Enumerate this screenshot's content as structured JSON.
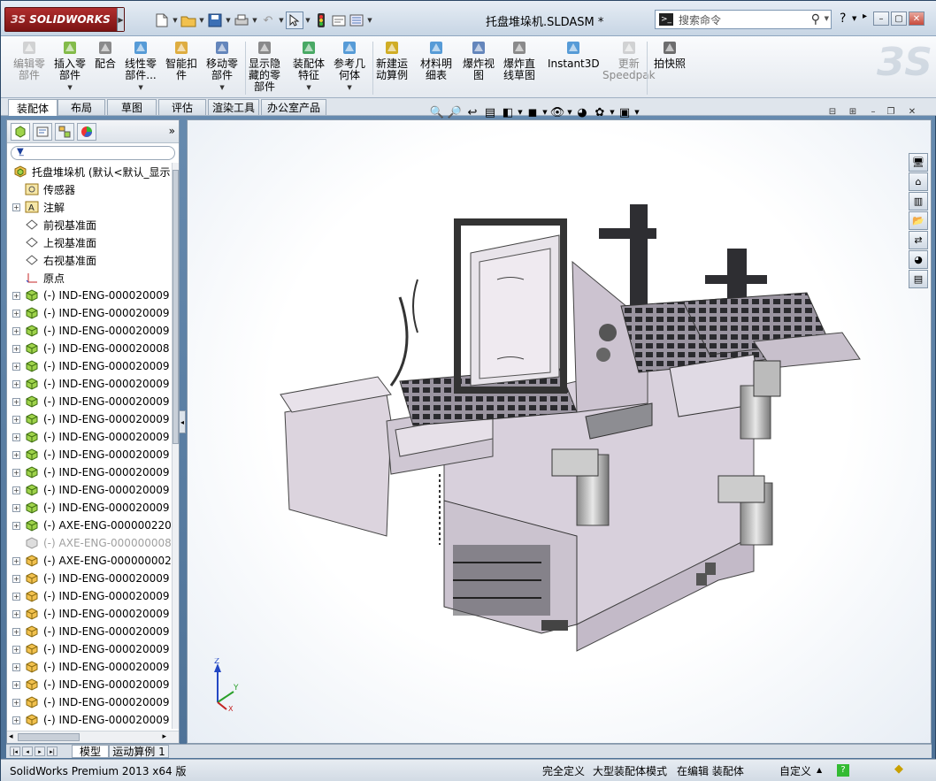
{
  "app": {
    "brand": "SOLIDWORKS",
    "title": "托盘堆垛机.SLDASM *",
    "search_placeholder": "搜索命令",
    "help_icon": "?"
  },
  "commands": [
    {
      "label1": "编辑零",
      "label2": "部件",
      "icon": "edit-component-icon",
      "disabled": true,
      "dropdown": false
    },
    {
      "label1": "插入零",
      "label2": "部件",
      "icon": "insert-component-icon",
      "disabled": false,
      "dropdown": true
    },
    {
      "label1": "配合",
      "label2": "",
      "icon": "mate-icon",
      "disabled": false,
      "dropdown": false
    },
    {
      "label1": "线性零",
      "label2": "部件...",
      "icon": "linear-pattern-icon",
      "disabled": false,
      "dropdown": true
    },
    {
      "label1": "智能扣",
      "label2": "件",
      "icon": "smart-fastener-icon",
      "disabled": false,
      "dropdown": false
    },
    {
      "label1": "移动零",
      "label2": "部件",
      "icon": "move-component-icon",
      "disabled": false,
      "dropdown": true
    },
    {
      "label1": "显示隐",
      "label2": "藏的零",
      "label3": "部件",
      "icon": "show-hidden-icon",
      "disabled": false,
      "dropdown": false
    },
    {
      "label1": "装配体",
      "label2": "特征",
      "icon": "assembly-feature-icon",
      "disabled": false,
      "dropdown": true
    },
    {
      "label1": "参考几",
      "label2": "何体",
      "icon": "reference-geometry-icon",
      "disabled": false,
      "dropdown": true
    },
    {
      "label1": "新建运",
      "label2": "动算例",
      "icon": "motion-study-icon",
      "disabled": false,
      "dropdown": false
    },
    {
      "label1": "材料明",
      "label2": "细表",
      "icon": "bom-icon",
      "disabled": false,
      "dropdown": false
    },
    {
      "label1": "爆炸视",
      "label2": "图",
      "icon": "exploded-view-icon",
      "disabled": false,
      "dropdown": false
    },
    {
      "label1": "爆炸直",
      "label2": "线草图",
      "icon": "explode-line-icon",
      "disabled": false,
      "dropdown": false
    },
    {
      "label1": "Instant3D",
      "label2": "",
      "icon": "instant3d-icon",
      "disabled": false,
      "dropdown": false
    },
    {
      "label1": "更新",
      "label2": "Speedpak",
      "icon": "speedpak-icon",
      "disabled": true,
      "dropdown": false
    },
    {
      "label1": "拍快照",
      "label2": "",
      "icon": "snapshot-icon",
      "disabled": false,
      "dropdown": false
    }
  ],
  "tabs": [
    "装配体",
    "布局",
    "草图",
    "评估",
    "渲染工具",
    "办公室产品"
  ],
  "tree": {
    "root": "托盘堆垛机 (默认<默认_显示",
    "items": [
      {
        "label": "传感器",
        "icon": "sensor-icon",
        "exp": false,
        "dim": false
      },
      {
        "label": "注解",
        "icon": "annotation-icon",
        "exp": true,
        "dim": false
      },
      {
        "label": "前视基准面",
        "icon": "plane-icon",
        "exp": false,
        "dim": false
      },
      {
        "label": "上视基准面",
        "icon": "plane-icon",
        "exp": false,
        "dim": false
      },
      {
        "label": "右视基准面",
        "icon": "plane-icon",
        "exp": false,
        "dim": false
      },
      {
        "label": "原点",
        "icon": "origin-icon",
        "exp": false,
        "dim": false
      },
      {
        "label": "(-) IND-ENG-000020009",
        "icon": "subassembly-icon",
        "exp": true,
        "dim": false
      },
      {
        "label": "(-) IND-ENG-000020009",
        "icon": "subassembly-icon",
        "exp": true,
        "dim": false
      },
      {
        "label": "(-) IND-ENG-000020009",
        "icon": "subassembly-icon",
        "exp": true,
        "dim": false
      },
      {
        "label": "(-) IND-ENG-000020008",
        "icon": "subassembly-icon",
        "exp": true,
        "dim": false
      },
      {
        "label": "(-) IND-ENG-000020009",
        "icon": "subassembly-icon",
        "exp": true,
        "dim": false
      },
      {
        "label": "(-) IND-ENG-000020009",
        "icon": "subassembly-icon",
        "exp": true,
        "dim": false
      },
      {
        "label": "(-) IND-ENG-000020009",
        "icon": "subassembly-icon",
        "exp": true,
        "dim": false
      },
      {
        "label": "(-) IND-ENG-000020009",
        "icon": "subassembly-icon",
        "exp": true,
        "dim": false
      },
      {
        "label": "(-) IND-ENG-000020009",
        "icon": "subassembly-icon",
        "exp": true,
        "dim": false
      },
      {
        "label": "(-) IND-ENG-000020009",
        "icon": "subassembly-icon",
        "exp": true,
        "dim": false
      },
      {
        "label": "(-) IND-ENG-000020009",
        "icon": "subassembly-icon",
        "exp": true,
        "dim": false
      },
      {
        "label": "(-) IND-ENG-000020009",
        "icon": "subassembly-icon",
        "exp": true,
        "dim": false
      },
      {
        "label": "(-) IND-ENG-000020009",
        "icon": "subassembly-icon",
        "exp": true,
        "dim": false
      },
      {
        "label": "(-) AXE-ENG-000000220",
        "icon": "subassembly-icon",
        "exp": true,
        "dim": false
      },
      {
        "label": "(-) AXE-ENG-000000008",
        "icon": "suppressed-icon",
        "exp": false,
        "dim": true
      },
      {
        "label": "(-) AXE-ENG-000000002",
        "icon": "part-icon",
        "exp": true,
        "dim": false
      },
      {
        "label": "(-) IND-ENG-000020009",
        "icon": "part-icon",
        "exp": true,
        "dim": false
      },
      {
        "label": "(-) IND-ENG-000020009",
        "icon": "part-icon",
        "exp": true,
        "dim": false
      },
      {
        "label": "(-) IND-ENG-000020009",
        "icon": "part-icon",
        "exp": true,
        "dim": false
      },
      {
        "label": "(-) IND-ENG-000020009",
        "icon": "part-icon",
        "exp": true,
        "dim": false
      },
      {
        "label": "(-) IND-ENG-000020009",
        "icon": "part-icon",
        "exp": true,
        "dim": false
      },
      {
        "label": "(-) IND-ENG-000020009",
        "icon": "part-icon",
        "exp": true,
        "dim": false
      },
      {
        "label": "(-) IND-ENG-000020009",
        "icon": "part-icon",
        "exp": true,
        "dim": false
      },
      {
        "label": "(-) IND-ENG-000020009",
        "icon": "part-icon",
        "exp": true,
        "dim": false
      },
      {
        "label": "(-) IND-ENG-000020009",
        "icon": "part-icon",
        "exp": true,
        "dim": false
      }
    ]
  },
  "model_tabs": [
    "模型",
    "运动算例 1"
  ],
  "status": {
    "product": "SolidWorks Premium 2013 x64 版",
    "defined": "完全定义",
    "mode": "大型装配体模式",
    "editing": "在编辑 装配体",
    "units": "自定义"
  },
  "colors": {
    "accent": "#b02e2e",
    "machine": "#d8d0dc",
    "frame_dark": "#3a3a3a"
  }
}
